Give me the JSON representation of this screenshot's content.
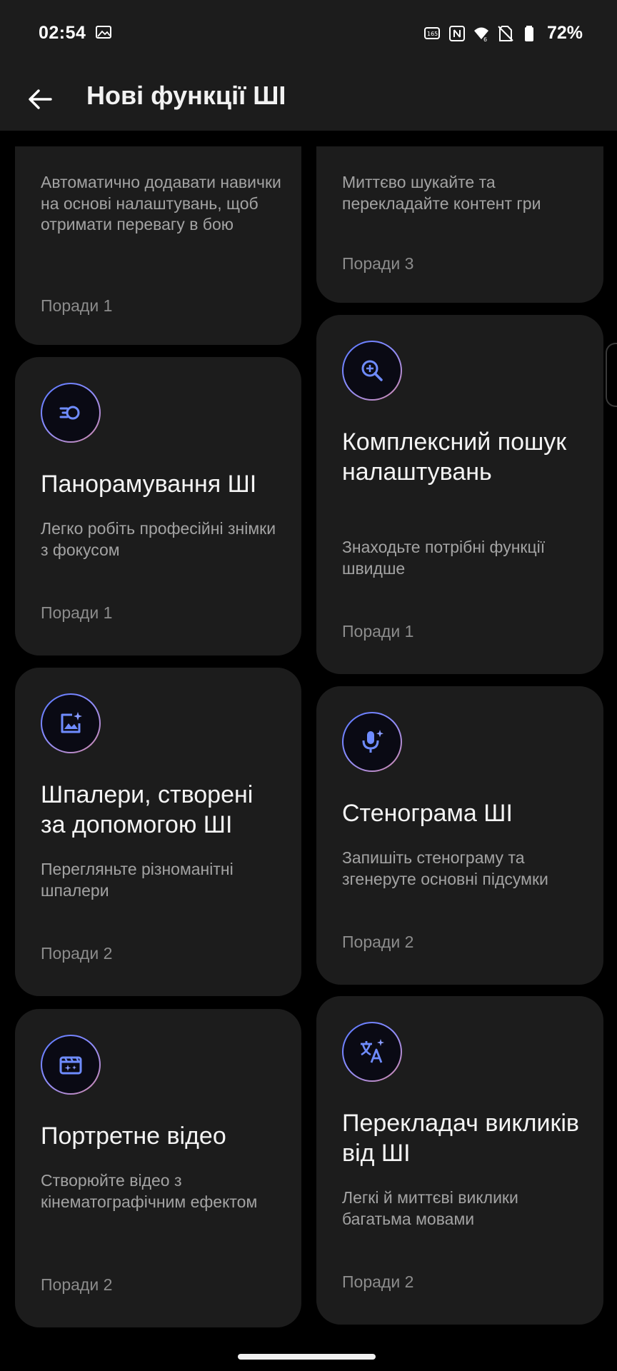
{
  "status": {
    "time": "02:54",
    "battery": "72%",
    "icons": [
      "image-icon",
      "refresh-rate-icon",
      "nfc-icon",
      "wifi-icon",
      "no-sim-icon",
      "battery-icon"
    ]
  },
  "header": {
    "title": "Нові функції ШІ",
    "back_icon": "arrow-left-icon"
  },
  "accent_colors": {
    "gradient_start": "#5a79ff",
    "gradient_end": "#d48aa8",
    "icon_glyph": "#6f8cff"
  },
  "cards": [
    {
      "title": "",
      "desc": "Автоматично додавати навички на основі налаштувань, щоб отримати перевагу в бою",
      "tips": "Поради 1"
    },
    {
      "title": "",
      "desc": "Миттєво шукайте та перекладайте контент гри",
      "tips": "Поради 3"
    },
    {
      "icon": "ai-pan-icon",
      "title": "Панорамування ШІ",
      "desc": "Легко робіть професійні знімки з фокусом",
      "tips": "Поради 1"
    },
    {
      "icon": "search-zoom-icon",
      "title": "Комплексний пошук налаштувань",
      "desc": "Знаходьте потрібні функції швидше",
      "tips": "Поради 1"
    },
    {
      "icon": "ai-wallpaper-icon",
      "title": "Шпалери, створені за допомогою ШІ",
      "desc": "Перегляньте різноманітні шпалери",
      "tips": "Поради 2"
    },
    {
      "icon": "microphone-ai-icon",
      "title": "Стенограма ШІ",
      "desc": "Запишіть стенограму та згенеруте основні підсумки",
      "tips": "Поради 2"
    },
    {
      "icon": "portrait-video-icon",
      "title": "Портретне відео",
      "desc": "Створюйте відео з кінематографічним ефектом",
      "tips": "Поради 2"
    },
    {
      "icon": "translate-icon",
      "title": "Перекладач викликів від ШІ",
      "desc": "Легкі й миттєві виклики багатьма мовами",
      "tips": "Поради 2"
    }
  ]
}
